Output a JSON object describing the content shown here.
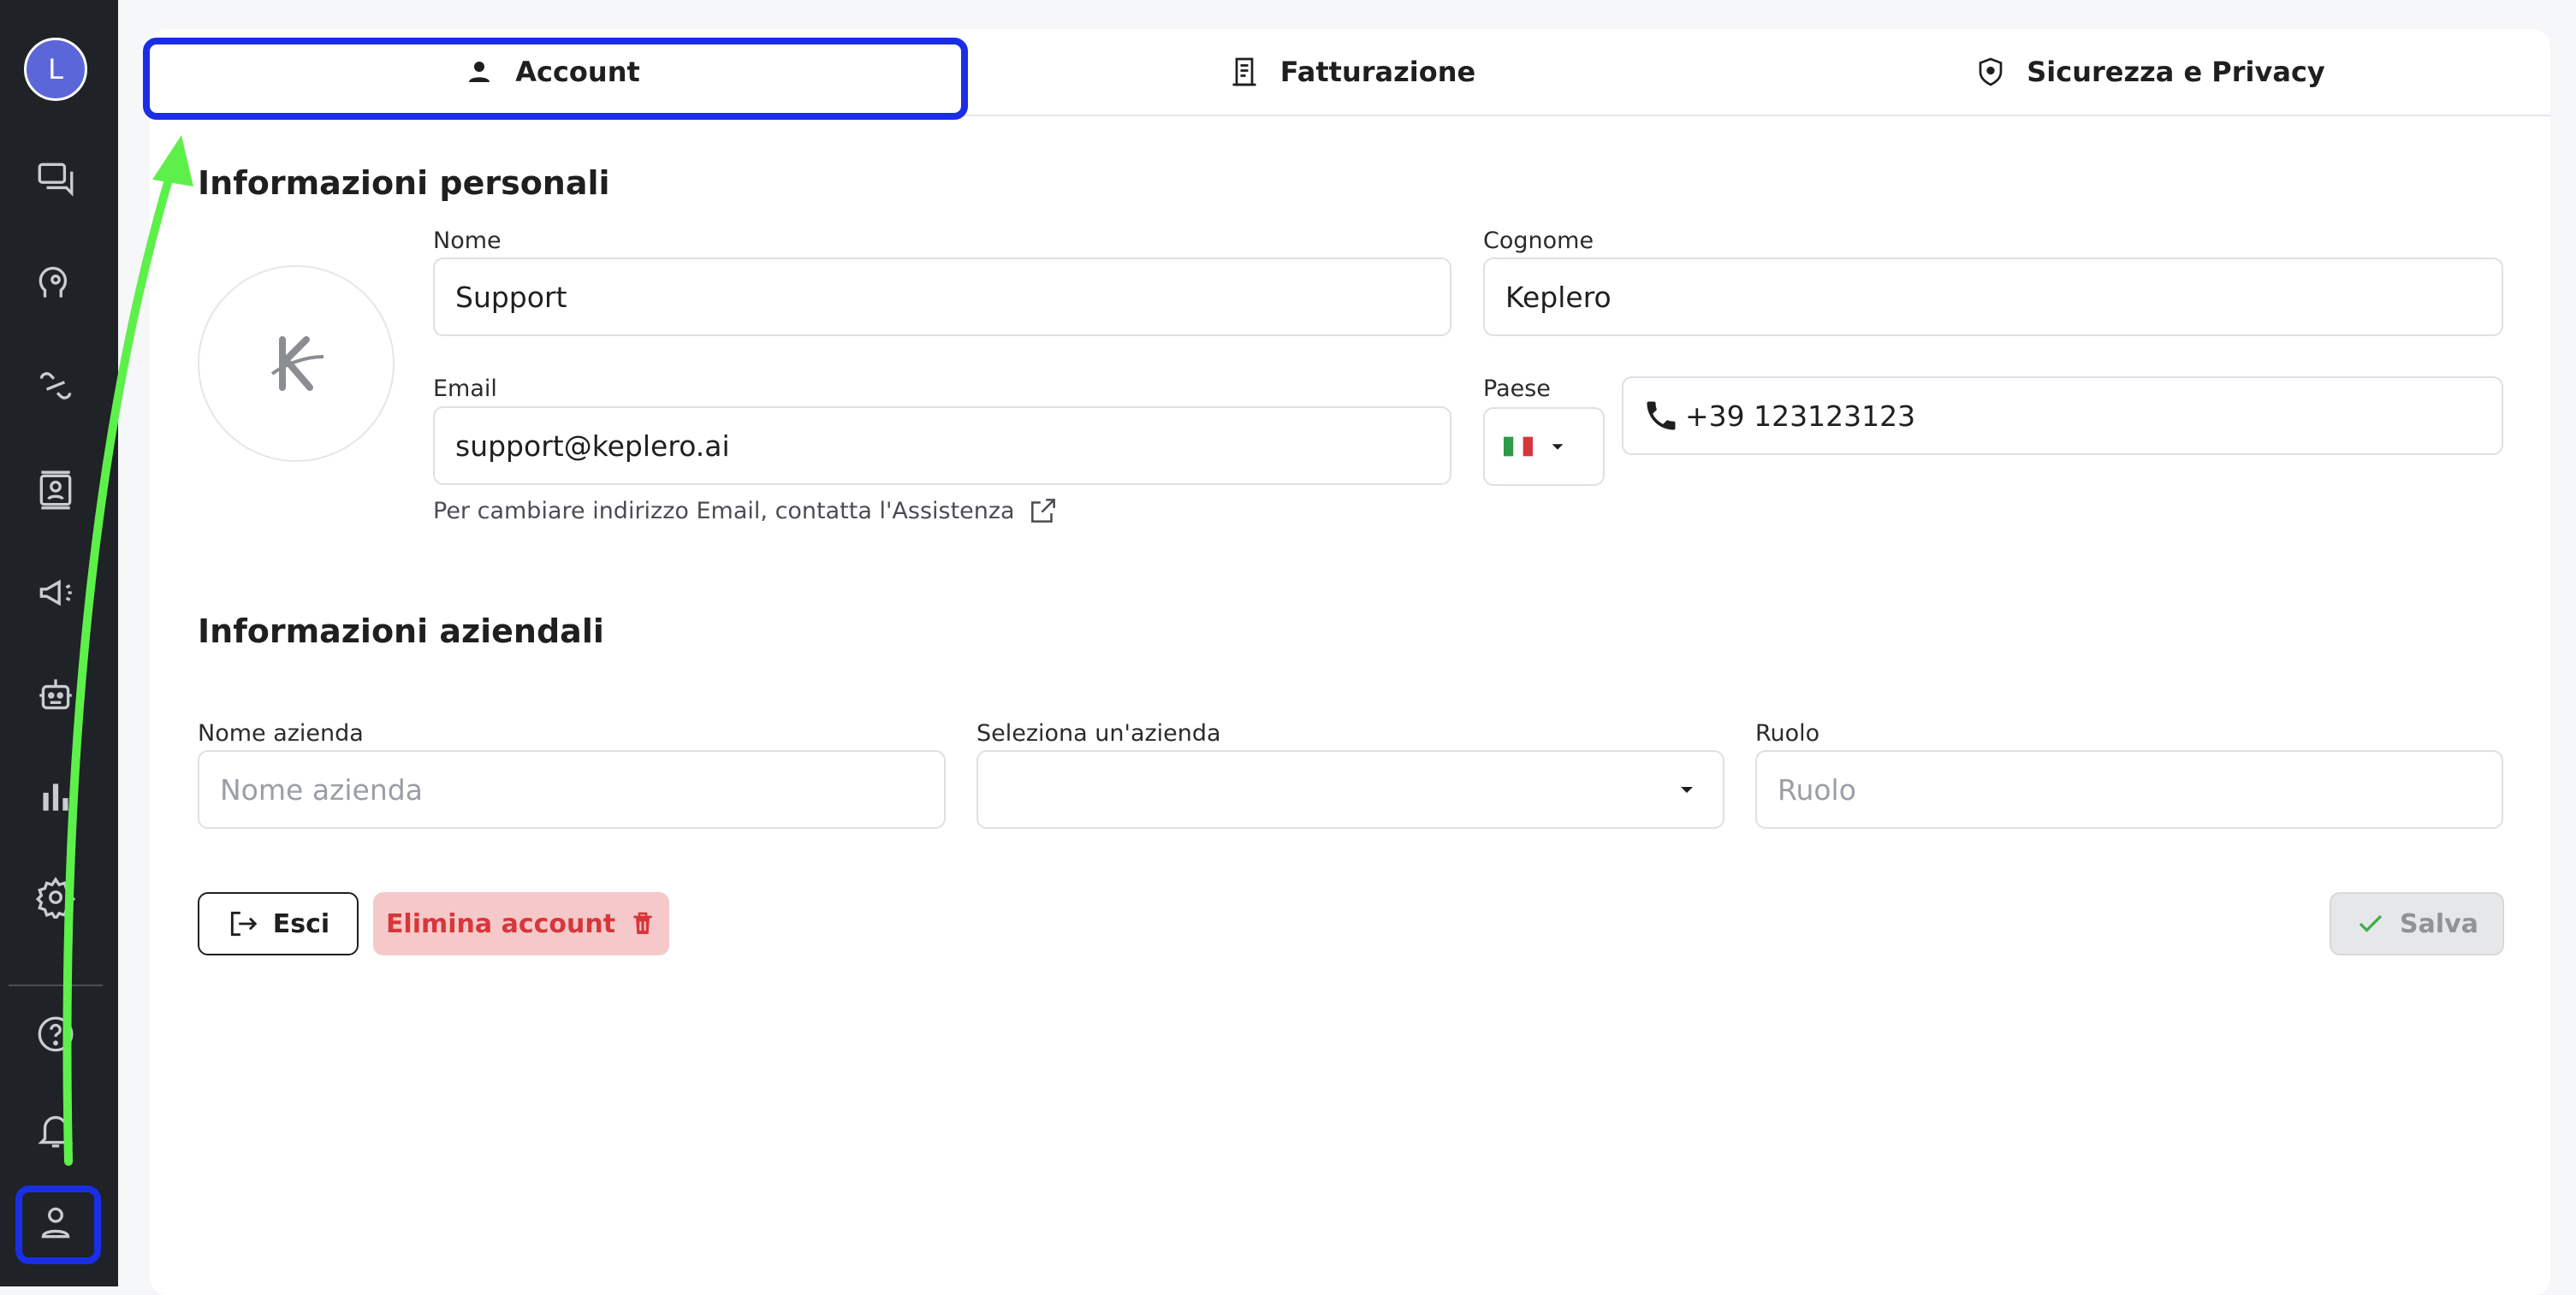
{
  "sidebar": {
    "avatar_letter": "L",
    "icons": [
      "chat-icon",
      "brain-icon",
      "integrations-icon",
      "contacts-icon",
      "megaphone-icon",
      "robot-icon",
      "chart-icon",
      "gear-icon",
      "help-icon",
      "bell-icon",
      "user-icon"
    ]
  },
  "tabs": [
    {
      "label": "Account",
      "icon": "person-icon"
    },
    {
      "label": "Fatturazione",
      "icon": "receipt-icon"
    },
    {
      "label": "Sicurezza e Privacy",
      "icon": "shield-icon"
    }
  ],
  "personal": {
    "title": "Informazioni personali",
    "nome_label": "Nome",
    "nome_value": "Support",
    "cognome_label": "Cognome",
    "cognome_value": "Keplero",
    "email_label": "Email",
    "email_value": "support@keplero.ai",
    "email_hint": "Per cambiare indirizzo Email, contatta l'Assistenza",
    "paese_label": "Paese",
    "country_flag": "italy-flag",
    "phone_value": "+39 123123123"
  },
  "business": {
    "title": "Informazioni aziendali",
    "company_label": "Nome azienda",
    "company_placeholder": "Nome azienda",
    "select_label": "Seleziona un'azienda",
    "select_value": "",
    "role_label": "Ruolo",
    "role_placeholder": "Ruolo"
  },
  "actions": {
    "exit_label": "Esci",
    "delete_label": "Elimina account",
    "save_label": "Salva"
  },
  "colors": {
    "highlight": "#1a2ee6",
    "arrow": "#5ef04a",
    "delete": "#d8363a",
    "sidebar": "#1f2227"
  }
}
